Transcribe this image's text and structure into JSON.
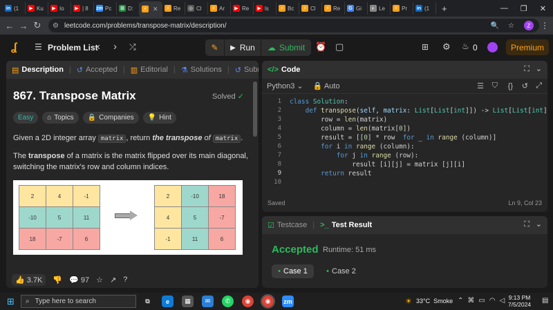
{
  "browser": {
    "tabs": [
      {
        "label": "(1",
        "fav": "in",
        "color": "#0a66c2"
      },
      {
        "label": "Ku",
        "fav": "▶",
        "color": "#ff0000"
      },
      {
        "label": "Io",
        "fav": "▶",
        "color": "#ff0000"
      },
      {
        "label": "| 8",
        "fav": "▶",
        "color": "#ff0000"
      },
      {
        "label": "Pc",
        "fav": "zm",
        "color": "#2d8cff"
      },
      {
        "label": "D:",
        "fav": "⊞",
        "color": "#1e8e3e"
      },
      {
        "label": "",
        "fav": "⚡",
        "color": "#ffa116",
        "active": true
      },
      {
        "label": "Re",
        "fav": "⚡",
        "color": "#ffa116"
      },
      {
        "label": "Cl",
        "fav": "◎",
        "color": "#555"
      },
      {
        "label": "Ar",
        "fav": "⚡",
        "color": "#ffa116"
      },
      {
        "label": "Re",
        "fav": "▶",
        "color": "#ff0000"
      },
      {
        "label": "ls",
        "fav": "▶",
        "color": "#ff0000"
      },
      {
        "label": "Bc",
        "fav": "⚡",
        "color": "#ffa116"
      },
      {
        "label": "Cl",
        "fav": "⚡",
        "color": "#ffa116"
      },
      {
        "label": "Re",
        "fav": "⚡",
        "color": "#ffa116"
      },
      {
        "label": "Gi",
        "fav": "G",
        "color": "#4285f4"
      },
      {
        "label": "Le",
        "fav": "◐",
        "color": "#888"
      },
      {
        "label": "Pr",
        "fav": "⚡",
        "color": "#ffa116"
      },
      {
        "label": "(1",
        "fav": "in",
        "color": "#0a66c2"
      }
    ],
    "url": "leetcode.com/problems/transpose-matrix/description/",
    "profile": "Z"
  },
  "header": {
    "problem_list": "Problem List",
    "run": "Run",
    "submit": "Submit",
    "streak": "0",
    "premium": "Premium"
  },
  "left_tabs": [
    "Description",
    "Accepted",
    "Editorial",
    "Solutions",
    "Submi"
  ],
  "problem": {
    "title": "867. Transpose Matrix",
    "status": "Solved",
    "tags": [
      "Easy",
      "Topics",
      "Companies",
      "Hint"
    ],
    "p1_a": "Given a 2D integer array ",
    "p1_code": "matrix",
    "p1_b": ", return ",
    "p1_em": "the transpose",
    "p1_c": " of ",
    "p1_code2": "matrix",
    "p1_d": ".",
    "p2_a": "The ",
    "p2_b": "transpose",
    "p2_c": " of a matrix is the matrix flipped over its main diagonal, switching the matrix's row and column indices.",
    "matrix_a": [
      [
        "2",
        "4",
        "-1"
      ],
      [
        "-10",
        "5",
        "11"
      ],
      [
        "18",
        "-7",
        "6"
      ]
    ],
    "matrix_b": [
      [
        "2",
        "-10",
        "18"
      ],
      [
        "4",
        "5",
        "-7"
      ],
      [
        "-1",
        "11",
        "6"
      ]
    ]
  },
  "footer_left": {
    "likes": "3.7K",
    "comments": "97"
  },
  "code_panel": {
    "title": "Code",
    "language": "Python3",
    "mode": "Auto",
    "saved": "Saved",
    "position": "Ln 9, Col 23",
    "line_numbers": [
      "1",
      "2",
      "3",
      "4",
      "5",
      "6",
      "7",
      "8",
      "9",
      "10"
    ]
  },
  "result_panel": {
    "tab1": "Testcase",
    "tab2": "Test Result",
    "status": "Accepted",
    "runtime": "Runtime: 51 ms",
    "cases": [
      "Case 1",
      "Case 2"
    ]
  },
  "taskbar": {
    "search_placeholder": "Type here to search",
    "weather": "33°C  Smoke",
    "time": "9:13 PM",
    "date": "7/5/2024"
  }
}
